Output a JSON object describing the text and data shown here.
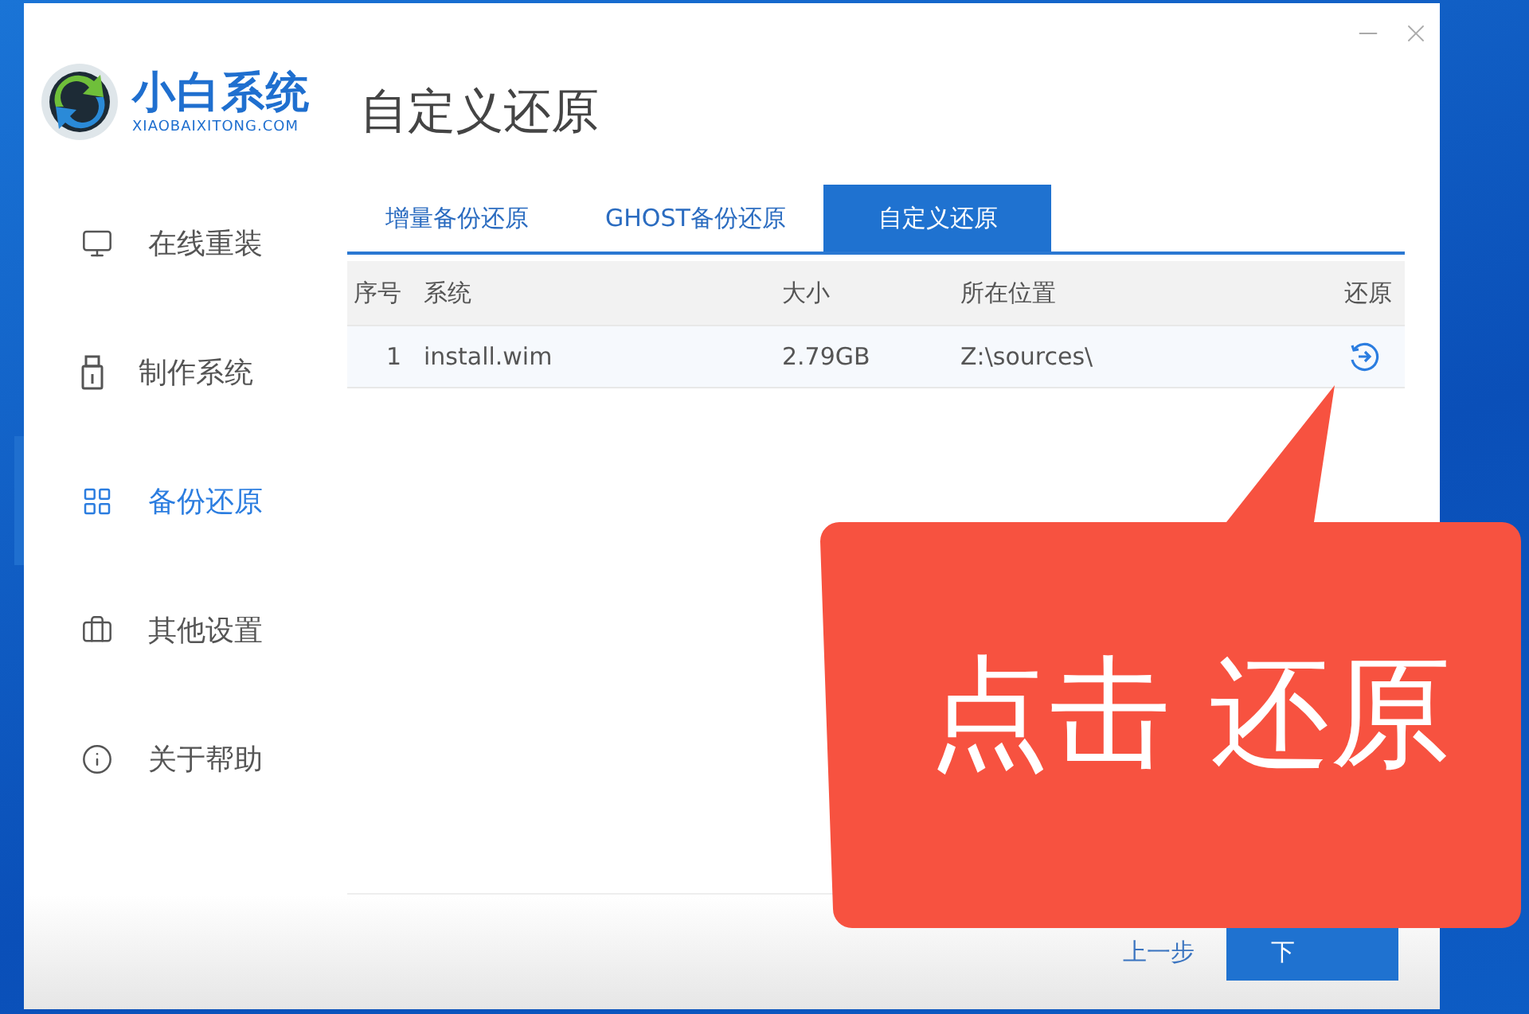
{
  "brand": {
    "name": "小白系统",
    "url": "XIAOBAIXITONG.COM"
  },
  "sidebar": {
    "items": [
      {
        "label": "在线重装",
        "kind": "monitor",
        "selected": false
      },
      {
        "label": "制作系统",
        "kind": "usb",
        "selected": false
      },
      {
        "label": "备份还原",
        "kind": "grid",
        "selected": true
      },
      {
        "label": "其他设置",
        "kind": "briefcase",
        "selected": false
      },
      {
        "label": "关于帮助",
        "kind": "info",
        "selected": false
      }
    ]
  },
  "page_title": "自定义还原",
  "tabs": [
    {
      "label": "增量备份还原",
      "selected": false
    },
    {
      "label": "GHOST备份还原",
      "selected": false
    },
    {
      "label": "自定义还原",
      "selected": true
    }
  ],
  "table": {
    "columns": [
      "序号",
      "系统",
      "大小",
      "所在位置",
      "还原"
    ],
    "rows": [
      {
        "cells": [
          "1",
          "install.wim",
          "2.79GB",
          "Z:\\sources\\"
        ]
      }
    ]
  },
  "footer": {
    "buttons": [
      {
        "label": "上一步",
        "kind": "link"
      },
      {
        "label": "下",
        "kind": "primary"
      }
    ]
  },
  "callout": {
    "text": "点击 还原"
  }
}
